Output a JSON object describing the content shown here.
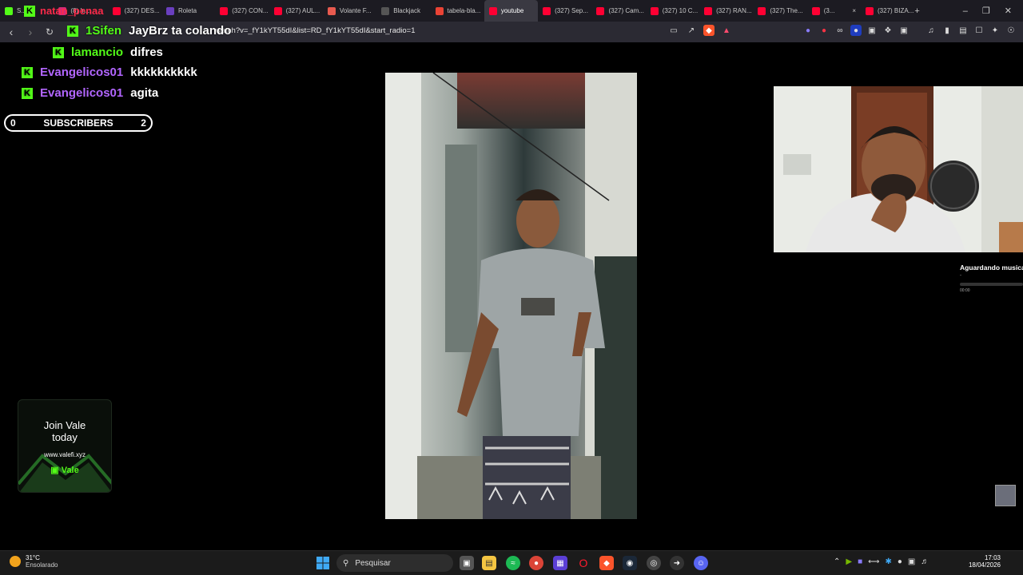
{
  "browser": {
    "tabs": [
      {
        "label": "S... m",
        "favicon": "kick-icon",
        "color": "#53fc18"
      },
      {
        "label": "(8) In...",
        "favicon": "instagram-icon",
        "color": "#d62976"
      },
      {
        "label": "(327) DES...",
        "favicon": "youtube-icon",
        "color": "#ff0033"
      },
      {
        "label": "Roleta",
        "favicon": "roleta-icon",
        "color": "#6a3fbf"
      },
      {
        "label": "(327) CON...",
        "favicon": "youtube-icon",
        "color": "#ff0033"
      },
      {
        "label": "(327) AUL...",
        "favicon": "youtube-icon",
        "color": "#ff0033"
      },
      {
        "label": "Volante F...",
        "favicon": "volante-icon",
        "color": "#e85a4f"
      },
      {
        "label": "Blackjack",
        "favicon": "blackjack-icon",
        "color": "#555"
      },
      {
        "label": "tabela-bla...",
        "favicon": "gmail-icon",
        "color": "#ea4335"
      },
      {
        "label": "youtube",
        "favicon": "youtube-icon",
        "color": "#ff0033",
        "active": true
      },
      {
        "label": "(327) Sep...",
        "favicon": "youtube-icon",
        "color": "#ff0033"
      },
      {
        "label": "(327) Cam...",
        "favicon": "youtube-icon",
        "color": "#ff0033"
      },
      {
        "label": "(327) 10 C...",
        "favicon": "youtube-icon",
        "color": "#ff0033"
      },
      {
        "label": "(327) RAN...",
        "favicon": "youtube-icon",
        "color": "#ff0033"
      },
      {
        "label": "(327) The...",
        "favicon": "youtube-icon",
        "color": "#ff0033"
      },
      {
        "label": "(3...",
        "favicon": "youtube-icon",
        "color": "#ff0033",
        "audio": true
      },
      {
        "label": "(327) BIZA...",
        "favicon": "youtube-icon",
        "color": "#ff0033"
      }
    ],
    "new_tab": "+",
    "url": "watch?v=_fY1kYT55dI&list=RD_fY1kYT55dI&start_radio=1"
  },
  "chat": {
    "overlay_user": "natan_penaa",
    "messages": [
      {
        "user": "1Sifen",
        "text": "JayBrz ta colando",
        "color": "#53fc18"
      },
      {
        "user": "lamancio",
        "text": "difres",
        "color": "#53fc18"
      },
      {
        "user": "Evangelicos01",
        "text": "kkkkkkkkkk",
        "color": "#b266ff"
      },
      {
        "user": "Evangelicos01",
        "text": "agita",
        "color": "#b266ff"
      }
    ]
  },
  "subs": {
    "left": "0",
    "label": "SUBSCRIBERS",
    "right": "2"
  },
  "music": {
    "title": "Aguardando musica",
    "subtitle": "-",
    "time": "00:00"
  },
  "ad": {
    "line1": "Join Vale",
    "line2": "today",
    "url": "www.valefi.xyz",
    "brand": "Vale"
  },
  "taskbar": {
    "temp": "31°C",
    "condition": "Ensolarado",
    "search": "Pesquisar",
    "time": "17:03",
    "date": "18/04/2026"
  },
  "colors": {
    "kick_green": "#53fc18",
    "purple_user": "#b266ff"
  }
}
